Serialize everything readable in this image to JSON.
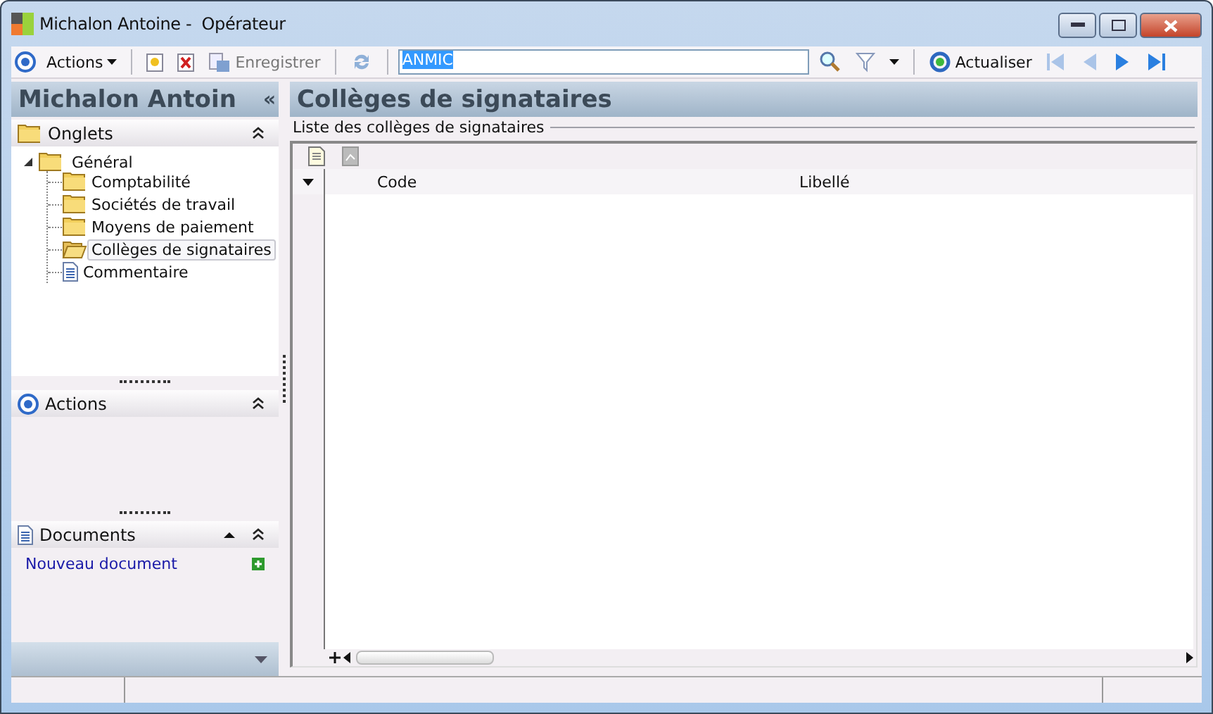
{
  "window": {
    "title": "Michalon Antoine -  Opérateur"
  },
  "toolbar": {
    "actions_menu": "Actions",
    "save": "Enregistrer",
    "search": {
      "value": "ANMIC"
    },
    "refresh": "Actualiser"
  },
  "sidebar": {
    "title": "Michalon Antoin",
    "collapse": "«",
    "onglets": {
      "title": "Onglets",
      "tree": [
        {
          "label": "Général",
          "kind": "folder",
          "selected": false,
          "expanded": true,
          "children": [
            {
              "label": "Comptabilité",
              "kind": "folder",
              "selected": false
            },
            {
              "label": "Sociétés de travail",
              "kind": "folder",
              "selected": false
            },
            {
              "label": "Moyens de paiement",
              "kind": "folder",
              "selected": false
            },
            {
              "label": "Collèges de signataires",
              "kind": "folder",
              "selected": true
            },
            {
              "label": "Commentaire",
              "kind": "document",
              "selected": false
            }
          ]
        }
      ]
    },
    "actions": {
      "title": "Actions"
    },
    "documents": {
      "title": "Documents",
      "links": [
        "Nouveau document"
      ]
    }
  },
  "content": {
    "title": "Collèges de signataires",
    "group_label": "Liste des collèges de signataires",
    "table": {
      "columns": [
        "Code",
        "Libellé"
      ]
    }
  }
}
